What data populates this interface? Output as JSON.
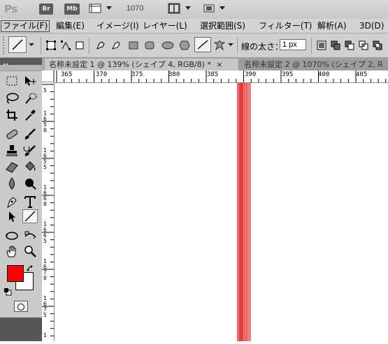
{
  "app": {
    "logo": "Ps",
    "bridge_button": "Br",
    "minibridge_button": "Mb",
    "zoom_level": "1070"
  },
  "menu": [
    {
      "label": "ファイル(F)"
    },
    {
      "label": "編集(E)"
    },
    {
      "label": "イメージ(I)"
    },
    {
      "label": "レイヤー(L)"
    },
    {
      "label": "選択範囲(S)"
    },
    {
      "label": "フィルター(T)"
    },
    {
      "label": "解析(A)"
    },
    {
      "label": "3D(D)"
    }
  ],
  "options": {
    "weight_label": "線の太さ：",
    "weight_value": "1 px"
  },
  "tabs": [
    {
      "label": "名称未設定 1 @ 139% (シェイプ 4, RGB/8) *",
      "close": "×"
    },
    {
      "label": "名称未設定 2 @ 1070% (シェイプ 2, R"
    }
  ],
  "rulers": {
    "horizontal": [
      "365",
      "370",
      "375",
      "380",
      "385",
      "390",
      "395",
      "400",
      "405"
    ],
    "vertical": [
      [
        "5"
      ],
      [
        "1",
        "6",
        "5",
        "0"
      ],
      [
        "1",
        "6",
        "5",
        "5"
      ],
      [
        "1",
        "6",
        "6",
        "0"
      ],
      [
        "1",
        "6",
        "6",
        "5"
      ],
      [
        "1",
        "6",
        "7",
        "0"
      ],
      [
        "1",
        "6",
        "7",
        "5"
      ],
      [
        "1"
      ]
    ]
  },
  "tools": {
    "foreground_color": "#ff0000",
    "background_color": "#ffffff",
    "selected_tool": "line"
  },
  "canvas": {
    "line_outer_color": "#f08080",
    "line_inner_color": "#e83c3c"
  }
}
